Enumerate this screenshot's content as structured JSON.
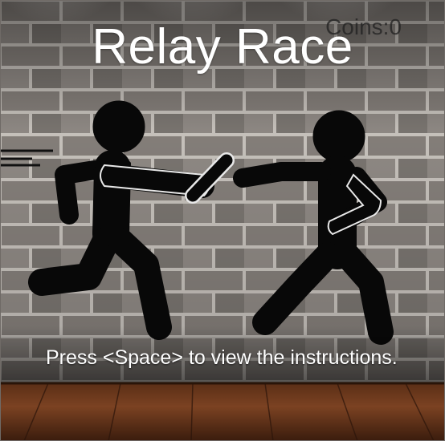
{
  "game": {
    "title": "Relay Race",
    "coins_label": "Coins:0",
    "instruction": "Press <Space> to view the instructions."
  },
  "scene": {
    "wall_color": "#8f8a86",
    "mortar_color": "#d6d2cd",
    "floor_color": "#7a3f20",
    "figure_color": "#080808",
    "baton_outline": "#f0f0f0"
  }
}
